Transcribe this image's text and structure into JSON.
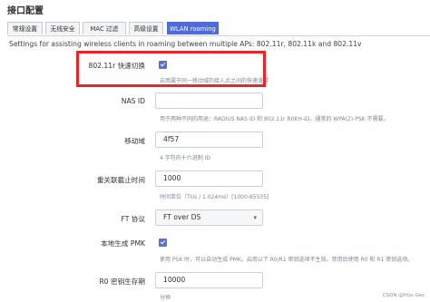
{
  "page_title": "接口配置",
  "tabs": [
    {
      "label": "常规设置"
    },
    {
      "label": "无线安全"
    },
    {
      "label": "MAC 过滤"
    },
    {
      "label": "高级设置"
    },
    {
      "label": "WLAN roaming"
    }
  ],
  "active_tab": "WLAN roaming",
  "description": "Settings for assisting wireless clients in roaming between multiple APs: 802.11r, 802.11k and 802.11v",
  "fields": {
    "ft_enable": {
      "label": "802.11r 快速切换",
      "checked": true,
      "help": "启用属于同一移动域的接入点之间的快速漫游"
    },
    "nas_id": {
      "label": "NAS ID",
      "value": "",
      "help": "用于两种不同的用途：RADIUS NAS ID 和 802.11r R0KH-ID。通常的 WPA(2)-PSK 不需要。"
    },
    "mobility_domain": {
      "label": "移动域",
      "value": "4f57",
      "help": "4 字符的十六进制 ID"
    },
    "reassoc_deadline": {
      "label": "重关联截止时间",
      "value": "1000",
      "help": "时间单位（TUs / 1.024ms）[1000-65535]"
    },
    "ft_protocol": {
      "label": "FT 协议",
      "value": "FT over DS"
    },
    "pmk_r1_push": {
      "label": "本地生成 PMK",
      "checked": true,
      "help": "使用 PSK 时，可以自动生成 PMK。启用以下 R0/R1 密钥选项不生效。禁用后使用 R0 和 R1 密钥选项。"
    },
    "r0_key_lifetime": {
      "label": "R0 密钥生存期",
      "value": "10000",
      "help": "分钟"
    }
  },
  "watermark": "CSDN @Hus-Ges"
}
